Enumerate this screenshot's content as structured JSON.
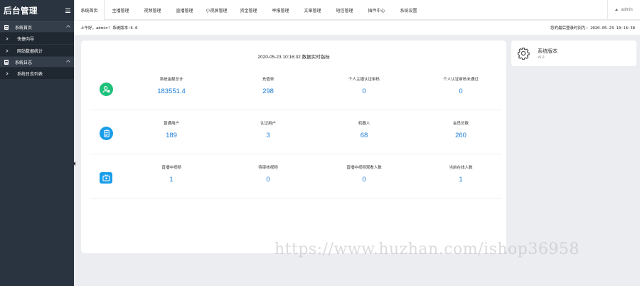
{
  "sidebar": {
    "title": "后台管理",
    "groups": [
      {
        "label": "系统首页",
        "items": [
          {
            "label": "快捷向导"
          },
          {
            "label": "网站数据统计"
          }
        ]
      },
      {
        "label": "系统日志",
        "items": [
          {
            "label": "系统日志列表"
          }
        ]
      }
    ]
  },
  "topnav": {
    "tabs": [
      {
        "label": "系统首页"
      },
      {
        "label": "主播管理"
      },
      {
        "label": "视频管理"
      },
      {
        "label": "直播管理"
      },
      {
        "label": "小视屏管理"
      },
      {
        "label": "资金管理"
      },
      {
        "label": "举报管理"
      },
      {
        "label": "文章管理"
      },
      {
        "label": "短信管理"
      },
      {
        "label": "插件中心"
      },
      {
        "label": "系统设置"
      }
    ],
    "user": "admin"
  },
  "infobar": {
    "greeting": "上午好，admin! 系统版本:6.0",
    "last_login": "您的最后登录时间为: 2020-05-23 10:16:30"
  },
  "main": {
    "title": "2020-05-23 10:16:32 数据实时指标",
    "rows": [
      {
        "icon": "money-icon",
        "stats": [
          {
            "label": "系统金额总计",
            "value": "183551.4"
          },
          {
            "label": "充值单",
            "value": "298"
          },
          {
            "label": "个人主播认证审核",
            "value": "0"
          },
          {
            "label": "个人认证审核未通过",
            "value": "0"
          }
        ]
      },
      {
        "icon": "clipboard-icon",
        "stats": [
          {
            "label": "普通用户",
            "value": "189"
          },
          {
            "label": "认证用户",
            "value": "3"
          },
          {
            "label": "机器人",
            "value": "68"
          },
          {
            "label": "会员总数",
            "value": "260"
          }
        ]
      },
      {
        "icon": "tv-icon",
        "stats": [
          {
            "label": "直播中视频",
            "value": "1"
          },
          {
            "label": "待审核视频",
            "value": "0"
          },
          {
            "label": "直播中视频观看人数",
            "value": "0"
          },
          {
            "label": "当前在线人数",
            "value": "1"
          }
        ]
      }
    ]
  },
  "side_card": {
    "title": "系统版本",
    "subtitle": "v6.0"
  },
  "watermark": "https://www.huzhan.com/ishop36958",
  "colors": {
    "sidebar_bg": "#2a3440",
    "accent_value": "#1a7bd6",
    "icon_green": "#1ec07a",
    "icon_blue": "#1a9de8"
  }
}
